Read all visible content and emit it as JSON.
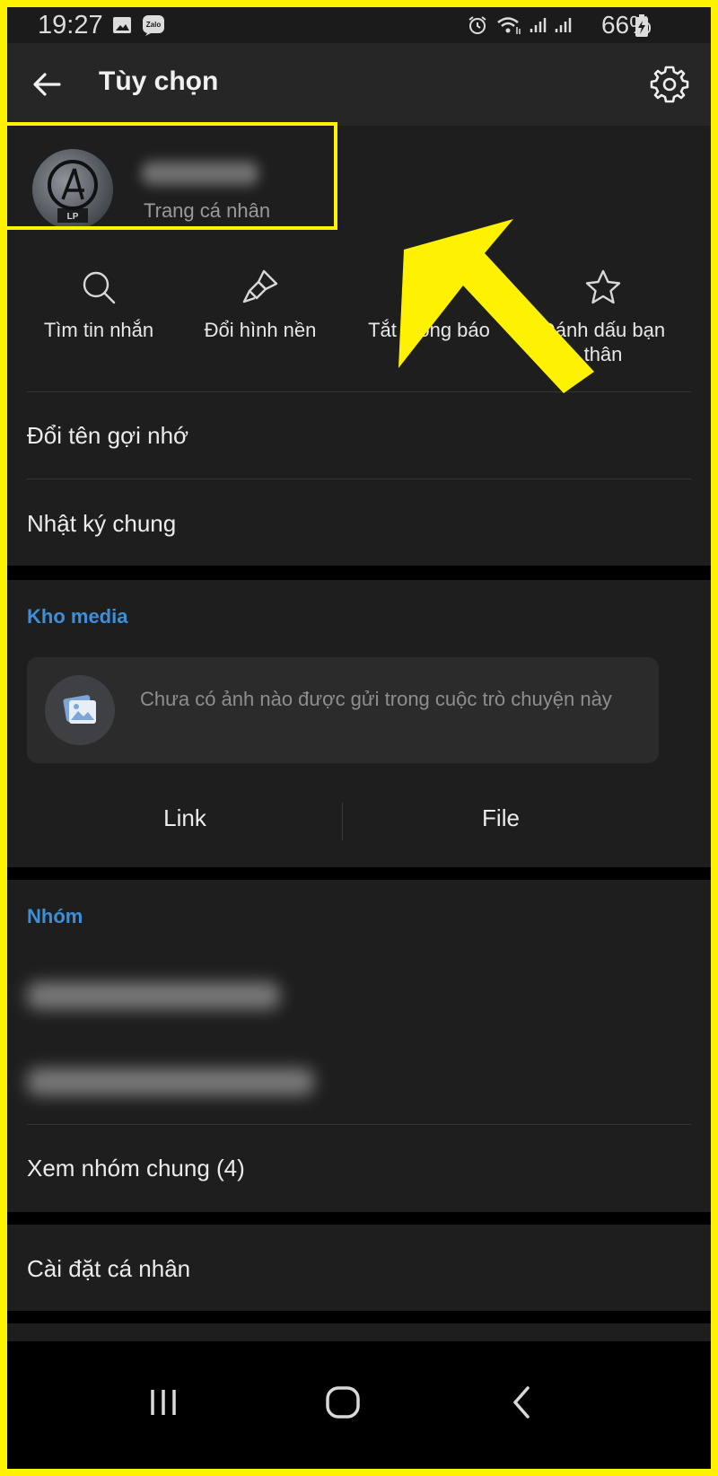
{
  "status_bar": {
    "time": "19:27",
    "battery": "66%"
  },
  "header": {
    "title": "Tùy chọn"
  },
  "profile": {
    "subtitle": "Trang cá nhân"
  },
  "actions": [
    {
      "label": "Tìm tin nhắn",
      "icon": "search-icon"
    },
    {
      "label": "Đổi hình nền",
      "icon": "brush-icon"
    },
    {
      "label": "Tắt thông báo",
      "icon": "bell-icon"
    },
    {
      "label": "Đánh dấu bạn thân",
      "icon": "star-icon"
    }
  ],
  "menu": {
    "rename": "Đổi tên gợi nhớ",
    "diary": "Nhật ký chung"
  },
  "media": {
    "section_label": "Kho media",
    "empty_text": "Chưa có ảnh nào được gửi trong cuộc trò chuyện này",
    "tab_link": "Link",
    "tab_file": "File"
  },
  "groups": {
    "section_label": "Nhóm",
    "view_common": "Xem nhóm chung (4)"
  },
  "personal": {
    "settings": "Cài đặt cá nhân"
  },
  "colors": {
    "accent_blue": "#3d8fd8",
    "highlight_yellow": "#fff200",
    "background": "#1e1e1e"
  }
}
